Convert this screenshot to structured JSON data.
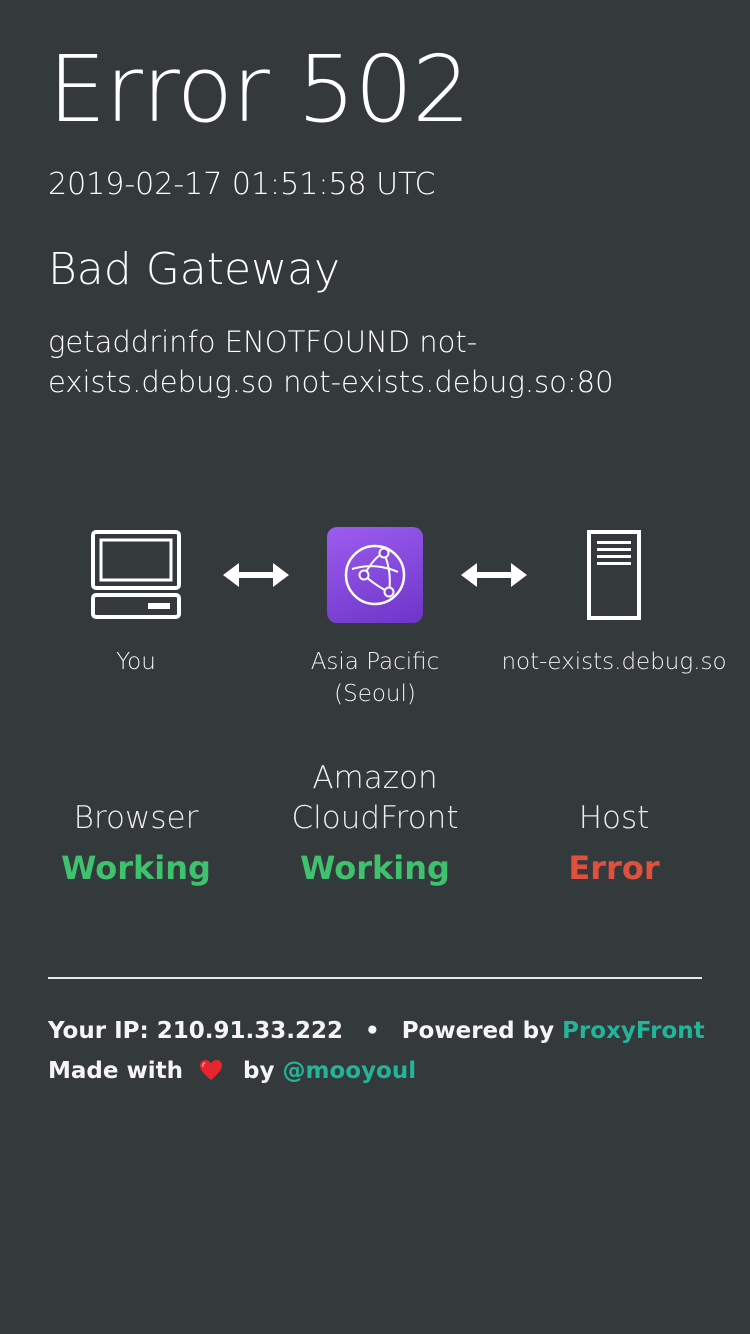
{
  "header": {
    "title": "Error 502",
    "timestamp": "2019-02-17 01:51:58 UTC",
    "status_heading": "Bad Gateway",
    "message": "getaddrinfo ENOTFOUND not-exists.debug.so not-exists.debug.so:80"
  },
  "diagram": {
    "nodes": [
      {
        "label": "You",
        "icon": "computer-icon"
      },
      {
        "label_line1": "Asia Pacific",
        "label_line2": "(Seoul)",
        "icon": "cloudfront-icon"
      },
      {
        "label": "not-exists.debug.so",
        "icon": "server-icon"
      }
    ],
    "arrow_icon": "double-arrow-icon"
  },
  "services": [
    {
      "name": "Browser",
      "state": "Working"
    },
    {
      "name_line1": "Amazon",
      "name_line2": "CloudFront",
      "state": "Working"
    },
    {
      "name": "Host",
      "state": "Error"
    }
  ],
  "colors": {
    "background": "#343a3c",
    "working": "#3ec26e",
    "error": "#e0503c",
    "link": "#22b59a",
    "cloudfront_badge": "#8a4de6"
  },
  "footer": {
    "ip_label": "Your IP:",
    "ip_value": "210.91.33.222",
    "separator": "•",
    "powered_by_label": "Powered by",
    "powered_by_link": "ProxyFront",
    "made_with_label": "Made with",
    "heart_icon": "heart-icon",
    "by_label": "by",
    "author_link": "@mooyoul"
  }
}
